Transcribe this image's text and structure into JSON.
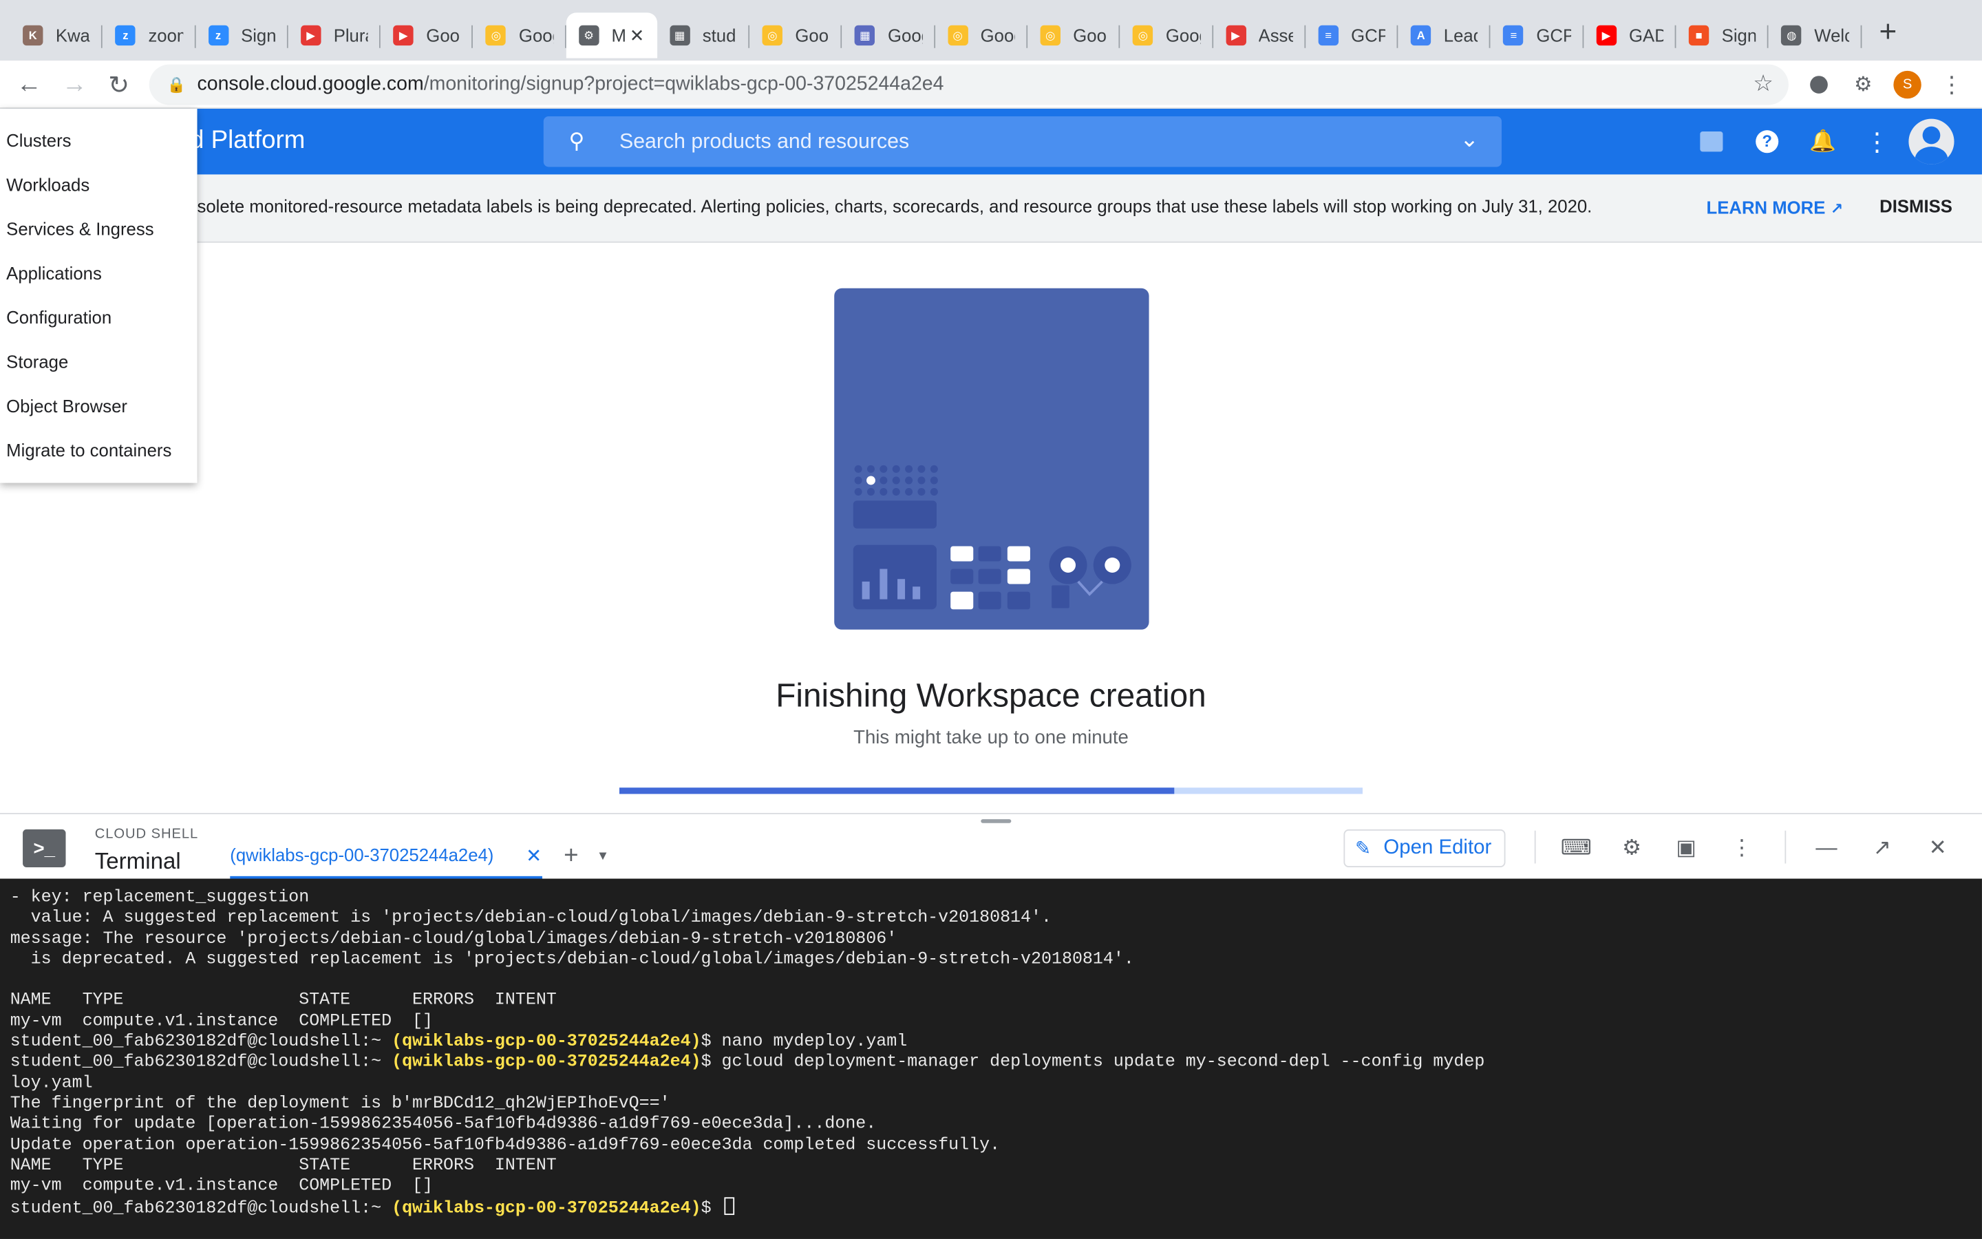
{
  "browser": {
    "tabs": [
      {
        "label": "Kwar",
        "color": "#8d6e63",
        "glyph": "K"
      },
      {
        "label": "zoom",
        "color": "#2d8cff",
        "glyph": "z"
      },
      {
        "label": "Sign",
        "color": "#2d8cff",
        "glyph": "z"
      },
      {
        "label": "Plura",
        "color": "#e53935",
        "glyph": "▶"
      },
      {
        "label": "Goog",
        "color": "#e53935",
        "glyph": "▶"
      },
      {
        "label": "Goog",
        "color": "#fbc02d",
        "glyph": "◎"
      },
      {
        "label": "M",
        "color": "#5f6368",
        "glyph": "⚙",
        "active": true
      },
      {
        "label": "stud",
        "color": "#5f6368",
        "glyph": "▦"
      },
      {
        "label": "Goog",
        "color": "#fbc02d",
        "glyph": "◎"
      },
      {
        "label": "Goog",
        "color": "#5c6bc0",
        "glyph": "▦"
      },
      {
        "label": "Goog",
        "color": "#fbc02d",
        "glyph": "◎"
      },
      {
        "label": "Goog",
        "color": "#fbc02d",
        "glyph": "◎"
      },
      {
        "label": "Goog",
        "color": "#fbc02d",
        "glyph": "◎"
      },
      {
        "label": "Asse",
        "color": "#e53935",
        "glyph": "▶"
      },
      {
        "label": "GCP",
        "color": "#4285f4",
        "glyph": "≡"
      },
      {
        "label": "Lead",
        "color": "#4285f4",
        "glyph": "A"
      },
      {
        "label": "GCP",
        "color": "#4285f4",
        "glyph": "≡"
      },
      {
        "label": "GAD",
        "color": "#ff0000",
        "glyph": "▶"
      },
      {
        "label": "Sign",
        "color": "#f25022",
        "glyph": "■"
      },
      {
        "label": "Welc",
        "color": "#5f6368",
        "glyph": "◍"
      }
    ],
    "url_host": "console.cloud.google.com",
    "url_path": "/monitoring/signup?project=qwiklabs-gcp-00-37025244a2e4",
    "profile_initial": "S"
  },
  "header": {
    "title": "oud Platform",
    "search_placeholder": "Search products and resources"
  },
  "banner": {
    "text": "solete monitored-resource metadata labels is being deprecated. Alerting policies, charts, scorecards, and resource groups that use these labels will stop working on July 31, 2020.",
    "learn_more": "LEARN MORE",
    "dismiss": "DISMISS"
  },
  "menu": {
    "items": [
      "Clusters",
      "Workloads",
      "Services & Ingress",
      "Applications",
      "Configuration",
      "Storage",
      "Object Browser",
      "Migrate to containers"
    ]
  },
  "main": {
    "title": "Finishing Workspace creation",
    "subtitle": "This might take up to one minute",
    "progress": 0.746
  },
  "shell": {
    "label": "CLOUD SHELL",
    "terminal_label": "Terminal",
    "session_tab": "(qwiklabs-gcp-00-37025244a2e4)",
    "open_editor": "Open Editor",
    "prompt_user": "student_00_fab6230182df@cloudshell:~ ",
    "prompt_project": "(qwiklabs-gcp-00-37025244a2e4)",
    "lines": [
      "- key: replacement_suggestion",
      "  value: A suggested replacement is 'projects/debian-cloud/global/images/debian-9-stretch-v20180814'.",
      "message: The resource 'projects/debian-cloud/global/images/debian-9-stretch-v20180806'",
      "  is deprecated. A suggested replacement is 'projects/debian-cloud/global/images/debian-9-stretch-v20180814'.",
      "",
      "NAME   TYPE                 STATE      ERRORS  INTENT",
      "my-vm  compute.v1.instance  COMPLETED  []"
    ],
    "cmd1": "$ nano mydeploy.yaml",
    "cmd2": "$ gcloud deployment-manager deployments update my-second-depl --config mydep",
    "cmd2_wrap": "loy.yaml",
    "lines2": [
      "The fingerprint of the deployment is b'mrBDCd12_qh2WjEPIhoEvQ=='",
      "Waiting for update [operation-1599862354056-5af10fb4d9386-a1d9f769-e0ece3da]...done.",
      "Update operation operation-1599862354056-5af10fb4d9386-a1d9f769-e0ece3da completed successfully.",
      "NAME   TYPE                 STATE      ERRORS  INTENT",
      "my-vm  compute.v1.instance  COMPLETED  []"
    ],
    "final_prompt_suffix": "$ "
  }
}
